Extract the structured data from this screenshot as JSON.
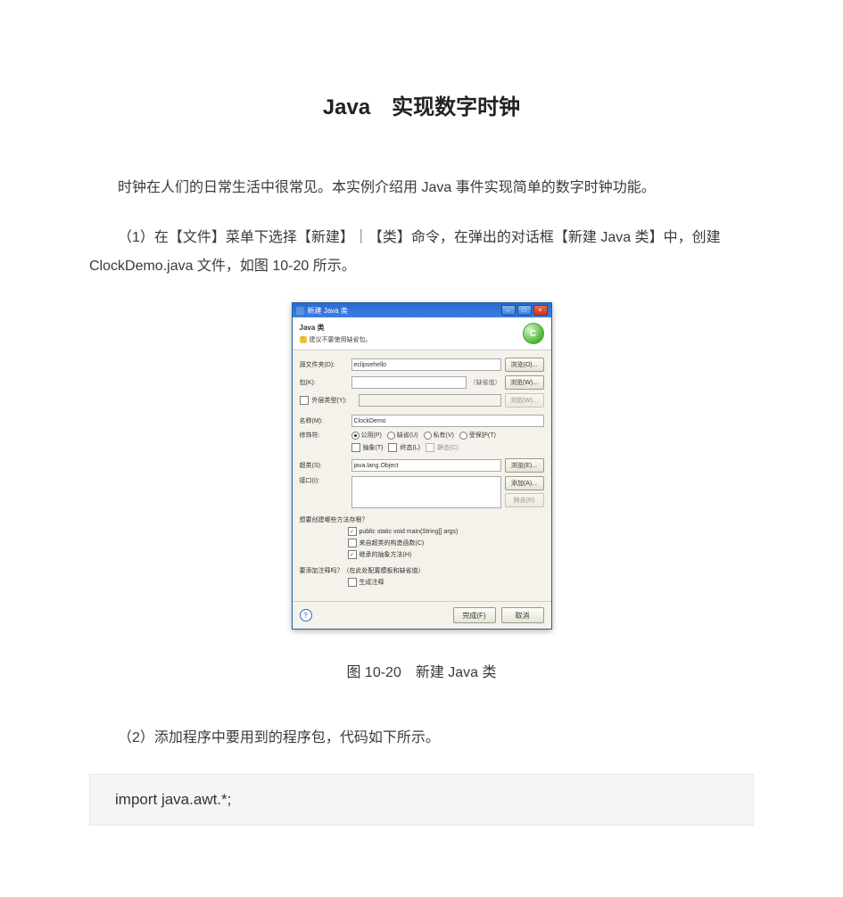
{
  "title": "Java　实现数字时钟",
  "para_intro": "时钟在人们的日常生活中很常见。本实例介绍用 Java 事件实现简单的数字时钟功能。",
  "para_step1": "（1）在【文件】菜单下选择【新建】｜【类】命令，在弹出的对话框【新建 Java 类】中，创建 ClockDemo.java 文件，如图 10-20 所示。",
  "caption": "图 10-20　新建 Java 类",
  "para_step2": "（2）添加程序中要用到的程序包，代码如下所示。",
  "code_line": "import  java.awt.*;",
  "dialog": {
    "window_title": "新建 Java 类",
    "titlebar": {
      "minimize": "–",
      "maximize": "□",
      "close": "×"
    },
    "head_title": "Java 类",
    "head_warning_icon": "!",
    "head_warning": "建议不要使用缺省包。",
    "head_badge": "C",
    "labels": {
      "source_folder": "源文件夹(D):",
      "package": "包(K):",
      "enclosing": "外层类型(Y):",
      "name": "名称(M):",
      "modifiers": "修饰符:",
      "superclass": "超类(S):",
      "interfaces": "接口(I):",
      "stubs_q": "想要创建哪些方法存根？",
      "comments_q": "要添加注释吗？（在此处配置模板和缺省值）"
    },
    "values": {
      "source_folder": "eclipsehello",
      "package": "（缺省值）",
      "name": "ClockDemo",
      "superclass": "java.lang.Object",
      "interfaces": ""
    },
    "radios": {
      "public": "公用(P)",
      "default": "缺省(U)",
      "private": "私有(V)",
      "protected": "受保护(T)",
      "abstract": "抽象(T)",
      "final": "终态(L)",
      "static": "静态(C)"
    },
    "checks": {
      "main": "public static void main(String[] args)",
      "inherited_abstract": "来自超类的构造函数(C)",
      "inherited_methods": "继承的抽象方法(H)",
      "gen_comments": "生成注释"
    },
    "buttons": {
      "browse1": "浏览(O)...",
      "browse2": "浏览(W)...",
      "browse3": "浏览(W)...",
      "browse4": "浏览(E)...",
      "add": "添加(A)...",
      "remove": "除去(R)",
      "finish": "完成(F)",
      "cancel": "取消"
    },
    "help": "?"
  }
}
